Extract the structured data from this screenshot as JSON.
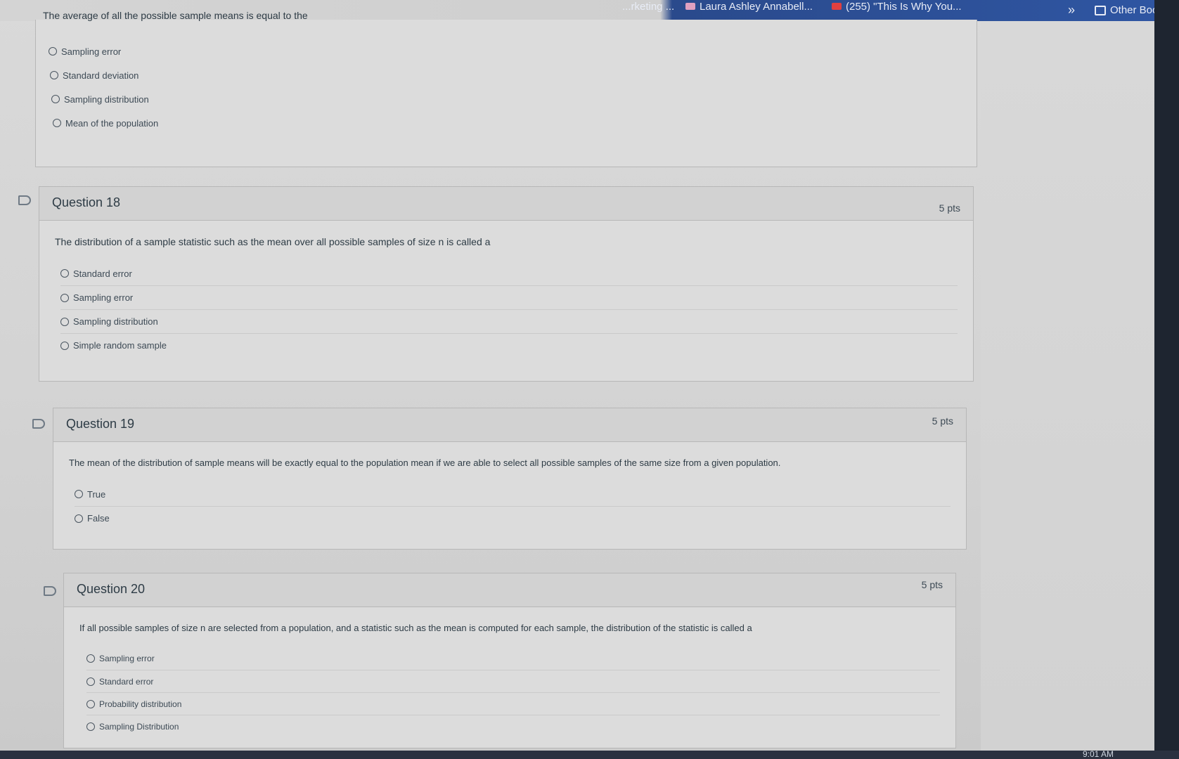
{
  "browser": {
    "bookmarks": [
      {
        "label": "...rketing ...",
        "color": "#cfd6ea"
      },
      {
        "label": "Laura Ashley Annabell...",
        "color": "#e0a0c0"
      },
      {
        "label": "(255) \"This Is Why You...",
        "color": "#e04040"
      }
    ],
    "other_bookmarks_label": "Other Bookmar"
  },
  "q17": {
    "text": "The average of all the possible sample means is equal to the",
    "answers": [
      "Sampling error",
      "Standard deviation",
      "Sampling distribution",
      "Mean of the population"
    ]
  },
  "q18": {
    "title": "Question 18",
    "points": "5 pts",
    "text": "The distribution of a sample statistic such as the mean over all possible samples of size n is called a",
    "answers": [
      "Standard error",
      "Sampling error",
      "Sampling distribution",
      "Simple random sample"
    ]
  },
  "q19": {
    "title": "Question 19",
    "points": "5 pts",
    "text": "The mean of the distribution of sample means will be exactly equal to the population mean if we are able to select all possible samples of the same size from a given population.",
    "answers": [
      "True",
      "False"
    ]
  },
  "q20": {
    "title": "Question 20",
    "points": "5 pts",
    "text": "If all possible samples of size n are selected from a population, and a statistic such as the mean is computed for each sample, the distribution of the statistic is called a",
    "answers": [
      "Sampling error",
      "Standard error",
      "Probability distribution",
      "Sampling Distribution"
    ]
  },
  "system": {
    "clock": "9:01 AM"
  }
}
